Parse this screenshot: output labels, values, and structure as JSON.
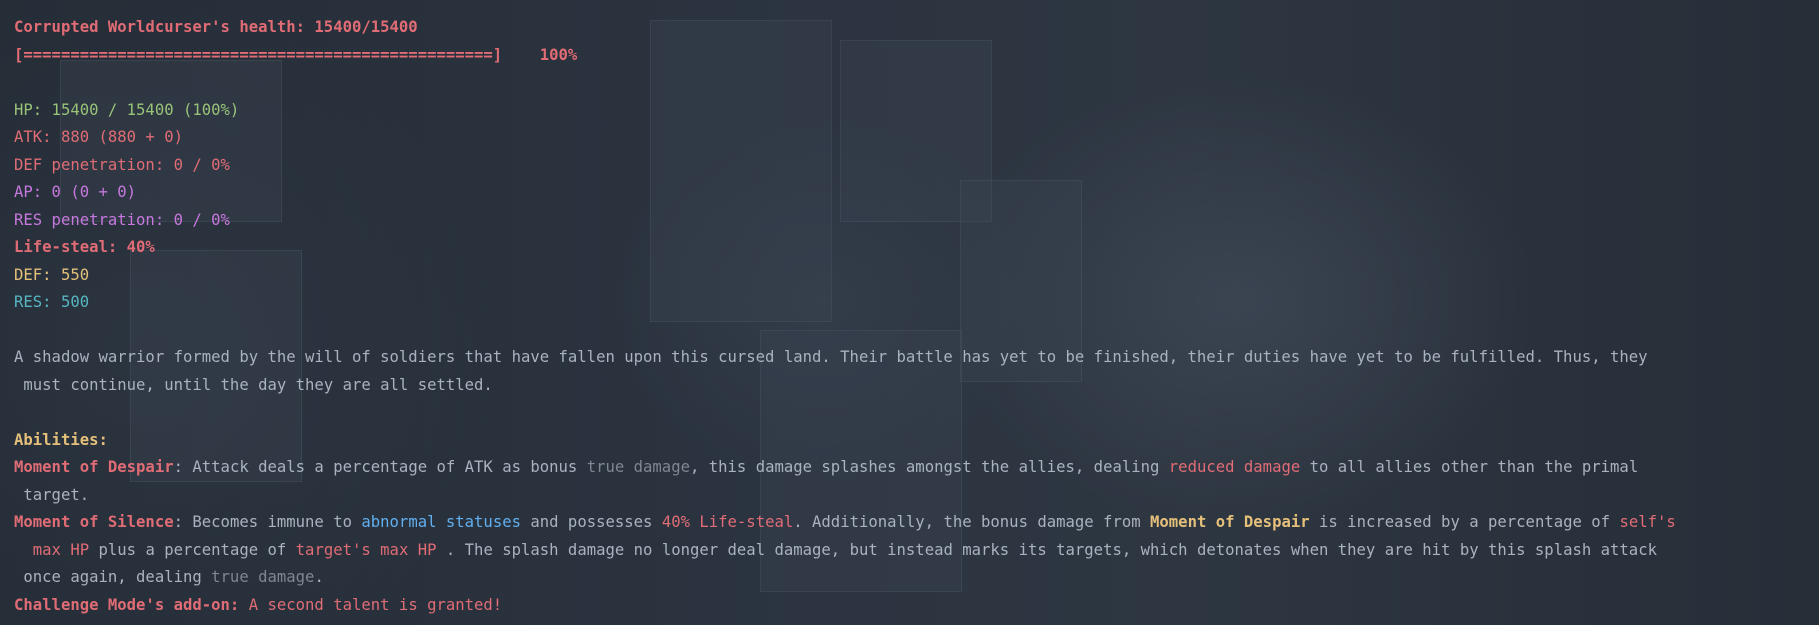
{
  "boss": {
    "health_label": "Corrupted Worldcurser's health: 15400/15400",
    "health_bar": "[==================================================]",
    "health_percent": "100%"
  },
  "stats": {
    "hp": "HP: 15400 / 15400 (100%)",
    "atk": "ATK: 880 (880 + 0)",
    "def_pen": "DEF penetration: 0 / 0%",
    "ap": "AP: 0 (0 + 0)",
    "res_pen": "RES penetration: 0 / 0%",
    "lifesteal": "Life-steal: 40%",
    "def": "DEF: 550",
    "res": "RES: 500"
  },
  "description": {
    "line1": "A shadow warrior formed by the will of soldiers that have fallen upon this cursed land. Their battle has yet to be finished, their duties have yet to be fulfilled. Thus, they",
    "line2": " must continue, until the day they are all settled."
  },
  "abilities": {
    "header": "Abilities:",
    "moment_of_despair": {
      "name": "Moment of Despair",
      "t1": ": Attack deals a percentage of ATK as bonus ",
      "k1": "true damage",
      "t2": ", this damage splashes amongst the allies, dealing ",
      "k2": "reduced damage",
      "t3": " to all allies other than the primal",
      "t4": " target."
    },
    "moment_of_silence": {
      "name": "Moment of Silence",
      "t1": ": Becomes immune to ",
      "k1": "abnormal",
      "k2": "statuses",
      "t2": " and possesses ",
      "k3": "40% Life-steal",
      "t3": ". Additionally, the bonus damage from ",
      "k4": "Moment of Despair",
      "t4": " is increased by a percentage of ",
      "k5": "self's",
      "k6": "max HP",
      "t5": " plus a percentage of ",
      "k7": "target's max HP",
      "t6": " . The splash damage no longer deal damage, but instead marks its targets, which detonates when they are hit by this splash attack",
      "t7": " once again, dealing ",
      "k8": "true damage",
      "t8": "."
    },
    "challenge_mode": {
      "label": "Challenge Mode's add-on:",
      "text": " A second talent is granted!"
    }
  },
  "colors": {
    "red": "#e06c75",
    "green": "#98c379",
    "purple": "#c678dd",
    "yellow": "#e5c07b",
    "cyan": "#56b6c2",
    "blue": "#61afef",
    "gray": "#7f8791",
    "text": "#aab2bf",
    "background": "#27303a"
  }
}
